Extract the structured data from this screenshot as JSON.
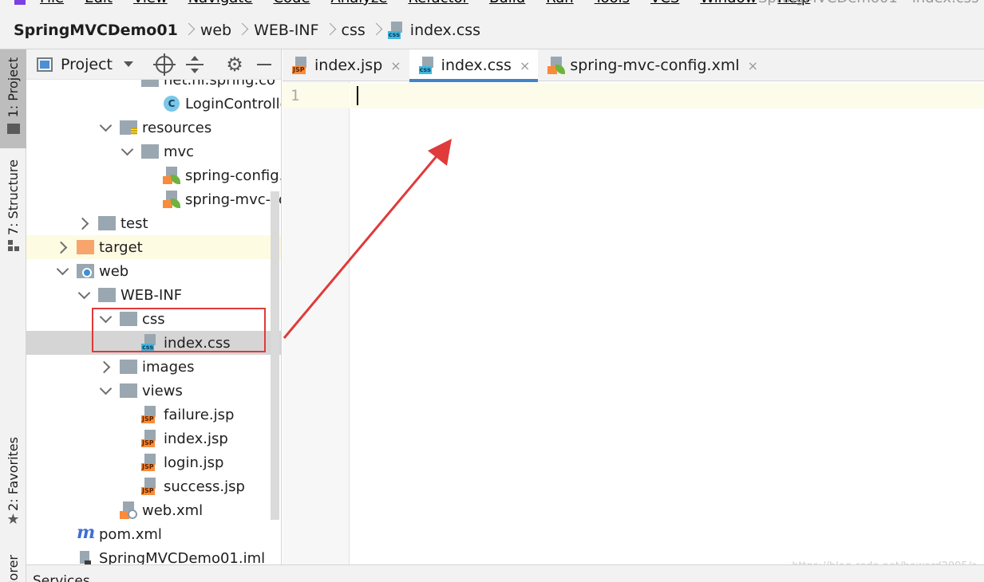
{
  "menu": {
    "items": [
      "File",
      "Edit",
      "View",
      "Navigate",
      "Code",
      "Analyze",
      "Refactor",
      "Build",
      "Run",
      "Tools",
      "VCS",
      "Window",
      "Help"
    ],
    "window_title": "SpringMVCDemo01 - index.css"
  },
  "breadcrumb": [
    "SpringMVCDemo01",
    "web",
    "WEB-INF",
    "css",
    "index.css"
  ],
  "toolstrip": {
    "project_tab": "1: Project",
    "structure_tab": "7: Structure",
    "favorites_tab": "2: Favorites",
    "explorer_tab": "lorer"
  },
  "panel": {
    "title": "Project",
    "tree": [
      {
        "label": "net.hi.spring.co",
        "depth": 5,
        "chevron": "none",
        "icon": "folder"
      },
      {
        "label": "LoginControlle",
        "depth": 6,
        "chevron": "none",
        "icon": "class"
      },
      {
        "label": "resources",
        "depth": 4,
        "chevron": "open",
        "icon": "folder-res"
      },
      {
        "label": "mvc",
        "depth": 5,
        "chevron": "open",
        "icon": "folder"
      },
      {
        "label": "spring-config.",
        "depth": 6,
        "chevron": "none",
        "icon": "xml"
      },
      {
        "label": "spring-mvc-co",
        "depth": 6,
        "chevron": "none",
        "icon": "xml"
      },
      {
        "label": "test",
        "depth": 3,
        "chevron": "closed",
        "icon": "folder"
      },
      {
        "label": "target",
        "depth": 2,
        "chevron": "closed",
        "icon": "folder-orange"
      },
      {
        "label": "web",
        "depth": 2,
        "chevron": "open",
        "icon": "folder-web"
      },
      {
        "label": "WEB-INF",
        "depth": 3,
        "chevron": "open",
        "icon": "folder"
      },
      {
        "label": "css",
        "depth": 4,
        "chevron": "open",
        "icon": "folder"
      },
      {
        "label": "index.css",
        "depth": 5,
        "chevron": "none",
        "icon": "css"
      },
      {
        "label": "images",
        "depth": 4,
        "chevron": "closed",
        "icon": "folder"
      },
      {
        "label": "views",
        "depth": 4,
        "chevron": "open",
        "icon": "folder"
      },
      {
        "label": "failure.jsp",
        "depth": 5,
        "chevron": "none",
        "icon": "jsp"
      },
      {
        "label": "index.jsp",
        "depth": 5,
        "chevron": "none",
        "icon": "jsp"
      },
      {
        "label": "login.jsp",
        "depth": 5,
        "chevron": "none",
        "icon": "jsp"
      },
      {
        "label": "success.jsp",
        "depth": 5,
        "chevron": "none",
        "icon": "jsp"
      },
      {
        "label": "web.xml",
        "depth": 4,
        "chevron": "none",
        "icon": "xml-web"
      },
      {
        "label": "pom.xml",
        "depth": 2,
        "chevron": "none",
        "icon": "pom"
      },
      {
        "label": "SpringMVCDemo01.iml",
        "depth": 2,
        "chevron": "none",
        "icon": "iml"
      }
    ]
  },
  "editor": {
    "tabs": [
      {
        "label": "index.jsp",
        "icon": "jsp",
        "active": false
      },
      {
        "label": "index.css",
        "icon": "css",
        "active": true
      },
      {
        "label": "spring-mvc-config.xml",
        "icon": "xml",
        "active": false
      }
    ],
    "line_numbers": [
      "1"
    ],
    "watermark": "https://blog.csdn.net/howard2005/a"
  },
  "bottom": {
    "services": "Services"
  },
  "icons": {
    "css_tag": "css",
    "jsp_tag": "JSP",
    "class_letter": "C",
    "pom_letter": "m",
    "gear": "⚙",
    "close": "×"
  },
  "colors": {
    "accent": "#4083c9",
    "highlight_box": "#e03a3a",
    "arrow": "#e03a3a"
  }
}
